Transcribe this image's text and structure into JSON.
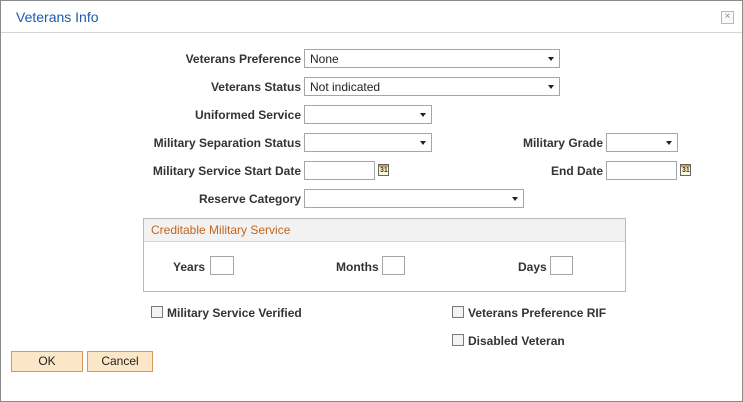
{
  "dialog": {
    "title": "Veterans Info",
    "close_glyph": "×"
  },
  "fields": {
    "veterans_preference": {
      "label": "Veterans Preference",
      "value": "None"
    },
    "veterans_status": {
      "label": "Veterans Status",
      "value": "Not indicated"
    },
    "uniformed_service": {
      "label": "Uniformed Service",
      "value": ""
    },
    "military_separation_status": {
      "label": "Military Separation Status",
      "value": ""
    },
    "military_grade": {
      "label": "Military Grade",
      "value": ""
    },
    "military_service_start_date": {
      "label": "Military Service Start Date",
      "value": ""
    },
    "end_date": {
      "label": "End Date",
      "value": ""
    },
    "reserve_category": {
      "label": "Reserve Category",
      "value": ""
    }
  },
  "calendar_icon_text": "31",
  "creditable": {
    "title": "Creditable Military Service",
    "years_label": "Years",
    "years_value": "",
    "months_label": "Months",
    "months_value": "",
    "days_label": "Days",
    "days_value": ""
  },
  "checkboxes": {
    "military_service_verified": {
      "label": "Military Service Verified",
      "checked": false
    },
    "veterans_preference_rif": {
      "label": "Veterans Preference RIF",
      "checked": false
    },
    "disabled_veteran": {
      "label": "Disabled Veteran",
      "checked": false
    }
  },
  "buttons": {
    "ok": "OK",
    "cancel": "Cancel"
  }
}
